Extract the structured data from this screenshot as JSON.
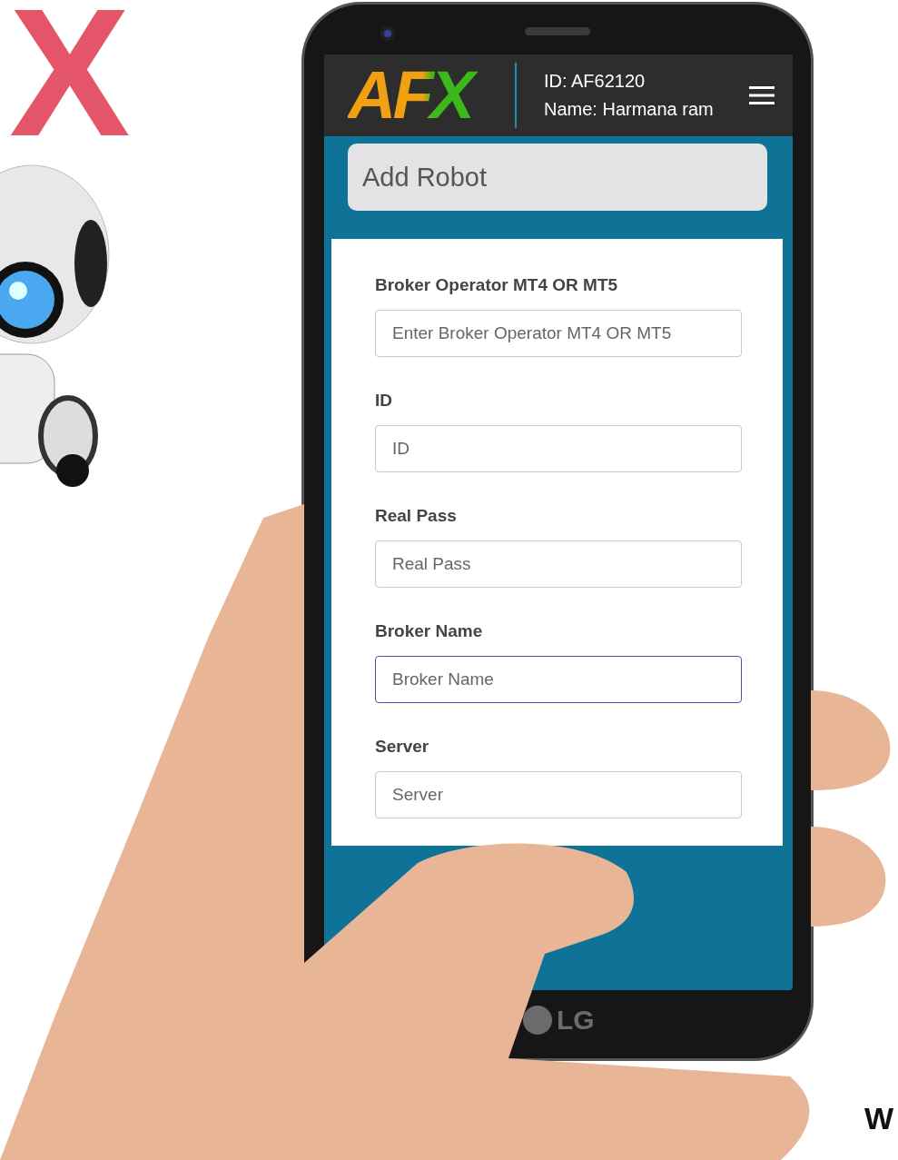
{
  "backdrop_logo": "X",
  "header": {
    "logo": "AFX",
    "id_line": "ID: AF62120",
    "name_line": "Name: Harmana ram"
  },
  "page_title": "Add Robot",
  "fields": [
    {
      "label": "Broker Operator MT4 OR MT5",
      "placeholder": "Enter Broker Operator MT4 OR MT5",
      "focused": false
    },
    {
      "label": "ID",
      "placeholder": "ID",
      "focused": false
    },
    {
      "label": "Real Pass",
      "placeholder": "Real Pass",
      "focused": false
    },
    {
      "label": "Broker Name",
      "placeholder": "Broker Name",
      "focused": true
    },
    {
      "label": "Server",
      "placeholder": "Server",
      "focused": false
    }
  ],
  "phone_brand": "LG",
  "corner_letter": "W"
}
